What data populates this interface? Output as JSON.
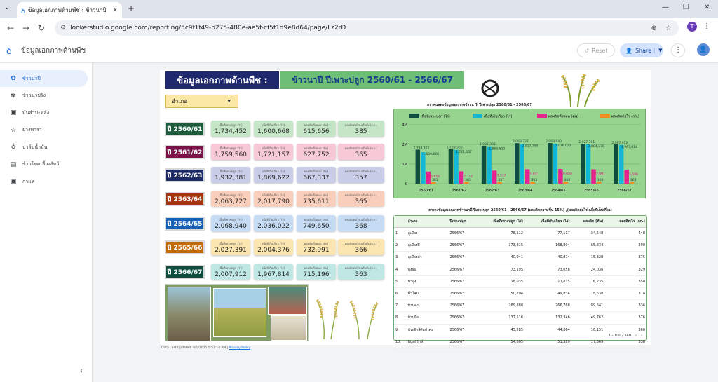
{
  "browser": {
    "tab_title": "ข้อมูลเอกภาพด้านพืช › ข้าวนาปี",
    "url": "lookerstudio.google.com/reporting/5c9f1f49-b275-480e-ae5f-cf5f1d9e8d64/page/Lz2rD",
    "profile_initial": "T"
  },
  "header": {
    "report_title": "ข้อมูลเอกภาพด้านพืช",
    "reset_label": "Reset",
    "share_label": "Share",
    "avatar_initial": "●"
  },
  "sidebar": {
    "items": [
      {
        "label": "ข้าวนาปี",
        "icon": "rice-icon",
        "active": true
      },
      {
        "label": "ข้าวนาปรัง",
        "icon": "flower-icon"
      },
      {
        "label": "มันสำปะหลัง",
        "icon": "cassava-icon"
      },
      {
        "label": "ยางพารา",
        "icon": "star-icon"
      },
      {
        "label": "ปาล์มน้ำมัน",
        "icon": "palm-icon"
      },
      {
        "label": "ข้าวโพดเลี้ยงสัตว์",
        "icon": "document-icon"
      },
      {
        "label": "กาแฟ",
        "icon": "coffee-icon"
      }
    ]
  },
  "report": {
    "title": "ข้อมูลเอกภาพด้านพืช :",
    "subtitle": "ข้าวนาปี ปีเพาะปลูก 2560/61 - 2566/67",
    "filter_label": "อำเภอ",
    "card_labels": [
      "เนื้อที่เพาะปลูก (ไร่)",
      "เนื้อที่เก็บเกี่ยว (ไร่)",
      "ผลผลิตทั้งหมด (ตัน)",
      "ผลผลิตต่อไร่เฉลี่ยทั้ง (ก.ก.)"
    ],
    "years": [
      {
        "label": "ปี 2560/61",
        "color": "#1e5a3c",
        "values": [
          "1,734,452",
          "1,600,668",
          "615,656",
          "385"
        ]
      },
      {
        "label": "ปี 2561/62",
        "color": "#7a1148",
        "values": [
          "1,759,560",
          "1,721,157",
          "627,752",
          "365"
        ]
      },
      {
        "label": "ปี 2562/63",
        "color": "#1c2a63",
        "values": [
          "1,932,381",
          "1,869,622",
          "667,337",
          "357"
        ]
      },
      {
        "label": "ปี 2563/64",
        "color": "#a4350e",
        "values": [
          "2,063,727",
          "2,017,790",
          "735,611",
          "365"
        ]
      },
      {
        "label": "ปี 2564/65",
        "color": "#1760b8",
        "values": [
          "2,068,940",
          "2,036,022",
          "749,650",
          "368"
        ]
      },
      {
        "label": "ปี 2565/66",
        "color": "#c26a06",
        "values": [
          "2,027,391",
          "2,004,376",
          "732,991",
          "366"
        ]
      },
      {
        "label": "ปี 2566/67",
        "color": "#0f4d3e",
        "values": [
          "2,007,912",
          "1,967,814",
          "715,196",
          "363"
        ]
      }
    ],
    "year_card_colors": [
      [
        "#c5e6c6",
        "#c5e6c6",
        "#c5e6c6",
        "#c5e6c6"
      ],
      [
        "#f7c8d5",
        "#f7c8d5",
        "#f7c8d5",
        "#f7c8d5"
      ],
      [
        "#c9cde8",
        "#c9cde8",
        "#c9cde8",
        "#c9cde8"
      ],
      [
        "#f9ceba",
        "#f9ceba",
        "#f9ceba",
        "#f9ceba"
      ],
      [
        "#c6dcf4",
        "#c6dcf4",
        "#c6dcf4",
        "#c6dcf4"
      ],
      [
        "#fbe5b0",
        "#fbe5b0",
        "#fbe5b0",
        "#fbe5b0"
      ],
      [
        "#bfe8e4",
        "#bfe8e4",
        "#bfe8e4",
        "#bfe8e4"
      ]
    ],
    "footer_updated": "Data Last Updated: 8/1/2025 5:52:14 PM",
    "footer_link": "Privacy Policy",
    "chart_title": "กราฟแสดงข้อมูลเอกภาพข้าวนาปี ปีเพาะปลูก 2560/61 - 2566/67",
    "table_title": "ตารางข้อมูลเอกภาพข้าวนาปี ปีเพาะปลูก 2560/61 - 2566/67   (ผลผลิตความชื้น 15%) ,(ผลผลิตต่อไร่เฉลี่ยที่เก็บเกี่ยว)",
    "table": {
      "headers": [
        "",
        "อำเภอ",
        "ปีเพาะปลูก",
        "เนื้อที่เพาะปลูก (ไร่)",
        "เนื้อที่เก็บเกี่ยว (ไร่)",
        "ผลผลิต (ตัน)",
        "ผลผลิต/ไร่ (กก.)"
      ],
      "rows": [
        [
          "1.",
          "คูเมือง",
          "2566/67",
          "78,112",
          "77,117",
          "34,548",
          "448"
        ],
        [
          "2.",
          "คูเมืองปี",
          "2566/67",
          "173,815",
          "168,804",
          "65,834",
          "390"
        ],
        [
          "3.",
          "คูเมืองคัว",
          "2566/67",
          "40,941",
          "40,874",
          "15,328",
          "375"
        ],
        [
          "4.",
          "ทุงฝน",
          "2566/67",
          "73,195",
          "73,058",
          "24,036",
          "329"
        ],
        [
          "5.",
          "นาอูง",
          "2566/67",
          "18,035",
          "17,815",
          "6,235",
          "350"
        ],
        [
          "6.",
          "น้ำโสม",
          "2566/67",
          "50,204",
          "49,834",
          "18,638",
          "374"
        ],
        [
          "7.",
          "บ้านดุง",
          "2566/67",
          "269,888",
          "266,788",
          "89,641",
          "336"
        ],
        [
          "8.",
          "บ้านผือ",
          "2566/67",
          "137,516",
          "132,346",
          "49,762",
          "376"
        ],
        [
          "9.",
          "ประจักษ์ศิลปาคม",
          "2566/67",
          "45,285",
          "44,864",
          "16,151",
          "360"
        ],
        [
          "10.",
          "พิบูลย์รักษ์",
          "2566/67",
          "54,805",
          "51,389",
          "17,369",
          "338"
        ]
      ],
      "pager": "1 - 100 / 140"
    }
  },
  "chart_data": {
    "type": "bar",
    "title": "กราฟแสดงข้อมูลเอกภาพข้าวนาปี ปีเพาะปลูก 2560/61 - 2566/67",
    "categories": [
      "2560/61",
      "2561/62",
      "2562/63",
      "2563/64",
      "2564/65",
      "2565/66",
      "2566/67"
    ],
    "ylim": [
      0,
      3000000
    ],
    "yticks": [
      "0",
      "1M",
      "2M",
      "3M"
    ],
    "legend_position": "top",
    "series": [
      {
        "name": "เนื้อที่เพาะปลูก (ไร่)",
        "color": "#0f4d3e",
        "values": [
          1734452,
          1759560,
          1932381,
          2063727,
          2068940,
          2027391,
          2007912
        ],
        "labels": [
          "1,734,452",
          "1,759,560",
          "1,932,381",
          "2,063,727",
          "2,068,940",
          "2,027,391",
          "2,007,912"
        ]
      },
      {
        "name": "เนื้อที่เก็บเกี่ยว (ไร่)",
        "color": "#13b7d6",
        "values": [
          1600668,
          1721157,
          1869622,
          2017790,
          2036022,
          2004376,
          1967814
        ],
        "labels": [
          "1,600,668",
          "1,721,157",
          "1,869,622",
          "2,017,790",
          "2,036,022",
          "2,004,376",
          "1,967,814"
        ]
      },
      {
        "name": "ผลผลิตทั้งหมด (ตัน)",
        "color": "#e6248f",
        "values": [
          615656,
          627752,
          667337,
          735611,
          749650,
          732991,
          715196
        ],
        "labels": [
          "615,656",
          "627,752",
          "667,337",
          "735,611",
          "749,650",
          "732,991",
          "715,196"
        ]
      },
      {
        "name": "ผลผลิตต่อไร่ (กก.)",
        "color": "#f08c1e",
        "values": [
          385,
          365,
          357,
          365,
          368,
          366,
          363
        ],
        "labels": [
          "385",
          "365",
          "357",
          "365",
          "368",
          "366",
          "363"
        ]
      }
    ]
  }
}
